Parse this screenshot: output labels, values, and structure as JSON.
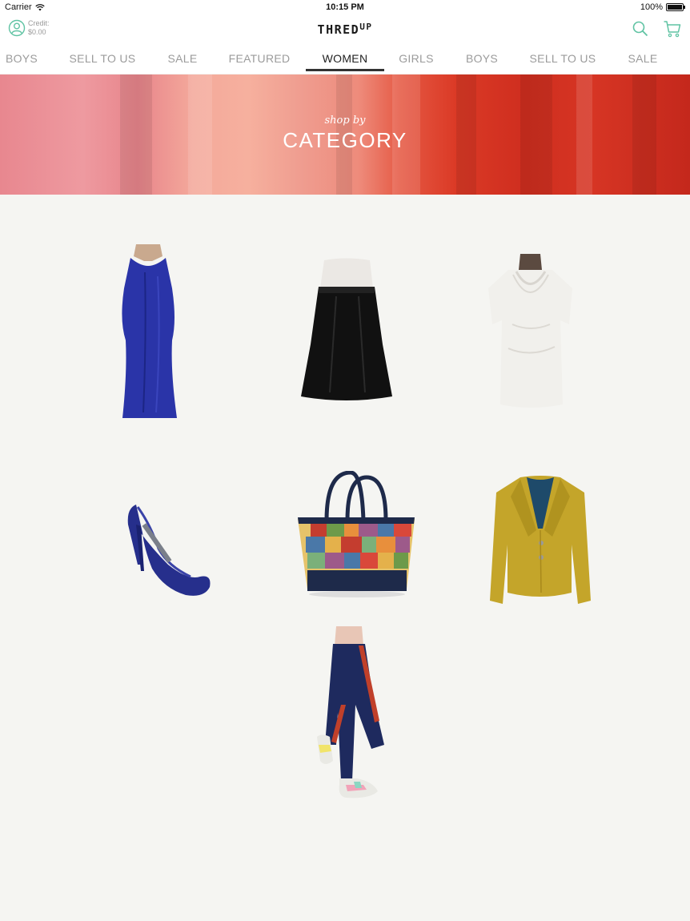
{
  "status_bar": {
    "carrier": "Carrier",
    "time": "10:15 PM",
    "battery": "100%"
  },
  "header": {
    "credit_label": "Credit:",
    "credit_value": "$0.00",
    "logo_main": "THRED",
    "logo_sup": "UP",
    "icons": [
      "account-icon",
      "search-icon",
      "cart-icon"
    ],
    "accent_color": "#5fc3a3"
  },
  "tabs": [
    {
      "label": "BOYS"
    },
    {
      "label": "SELL TO US"
    },
    {
      "label": "SALE"
    },
    {
      "label": "FEATURED"
    },
    {
      "label": "WOMEN",
      "active": true
    },
    {
      "label": "GIRLS"
    },
    {
      "label": "BOYS"
    },
    {
      "label": "SELL TO US"
    },
    {
      "label": "SALE"
    }
  ],
  "banner": {
    "subtitle": "shop by",
    "title": "CATEGORY"
  },
  "categories": [
    {
      "item": "dress",
      "color": "#2a34a8"
    },
    {
      "item": "skirt",
      "color": "#111111"
    },
    {
      "item": "top",
      "color": "#f1f0ec"
    },
    {
      "item": "shoes",
      "color": "#262f8c"
    },
    {
      "item": "handbag",
      "color": "#c43d2f"
    },
    {
      "item": "blazer",
      "color": "#c4a52a"
    },
    {
      "item": "activewear",
      "color": "#1e2a5e"
    }
  ]
}
